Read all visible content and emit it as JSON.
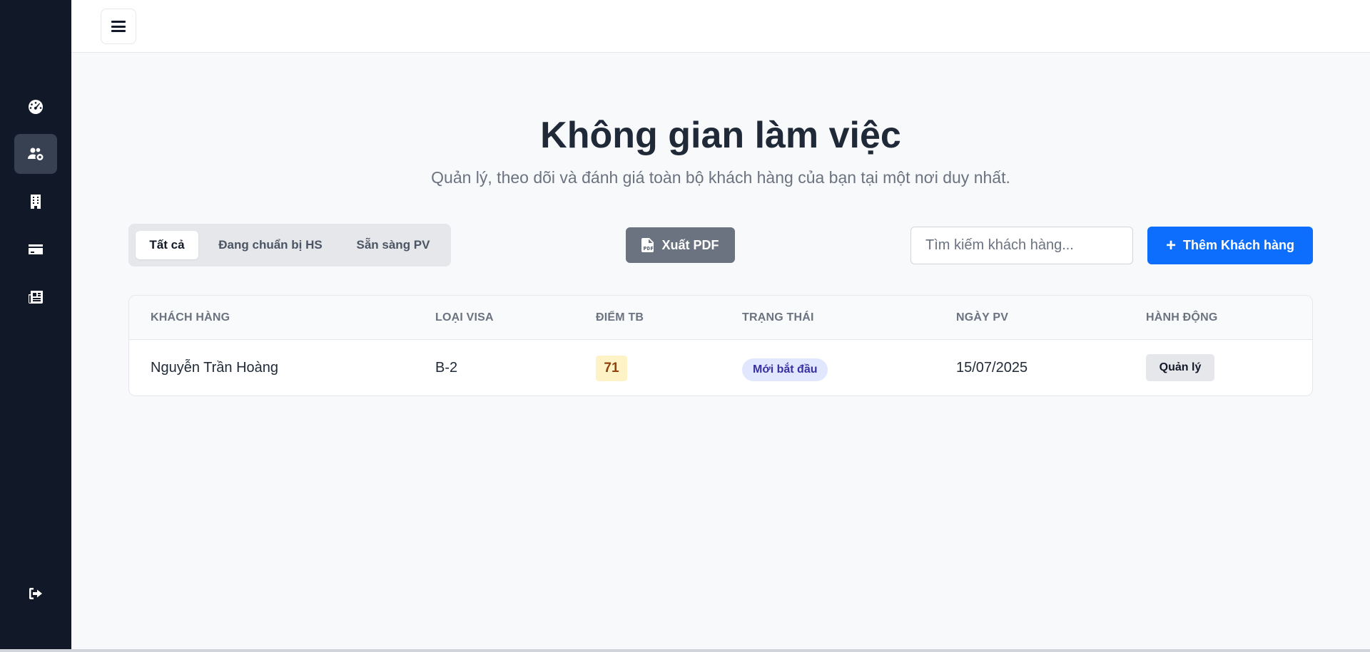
{
  "header": {
    "title": "Không gian làm việc",
    "subtitle": "Quản lý, theo dõi và đánh giá toàn bộ khách hàng của bạn tại một nơi duy nhất."
  },
  "sidebar": {
    "items": [
      {
        "icon": "dashboard-icon"
      },
      {
        "icon": "users-cog-icon",
        "active": true
      },
      {
        "icon": "building-icon"
      },
      {
        "icon": "credit-card-icon"
      },
      {
        "icon": "newspaper-icon"
      }
    ],
    "logout_icon": "logout-icon"
  },
  "tabs": [
    {
      "label": "Tất cả",
      "active": true
    },
    {
      "label": "Đang chuẩn bị HS"
    },
    {
      "label": "Sẵn sàng PV"
    }
  ],
  "toolbar": {
    "export_label": "Xuất PDF",
    "search_placeholder": "Tìm kiếm khách hàng...",
    "search_value": "",
    "add_label": "Thêm Khách hàng"
  },
  "table": {
    "columns": [
      "KHÁCH HÀNG",
      "LOẠI VISA",
      "ĐIỂM TB",
      "TRẠNG THÁI",
      "NGÀY PV",
      "HÀNH ĐỘNG"
    ],
    "rows": [
      {
        "customer": "Nguyễn Trần Hoàng",
        "visa_type": "B-2",
        "score": "71",
        "status": "Mới bắt đầu",
        "interview_date": "15/07/2025",
        "action": "Quản lý"
      }
    ]
  },
  "colors": {
    "sidebar_bg": "#111827",
    "primary": "#0d6efd",
    "secondary": "#6b7280",
    "score_bg": "#fef3c7",
    "status_bg": "#e0e7ff"
  }
}
